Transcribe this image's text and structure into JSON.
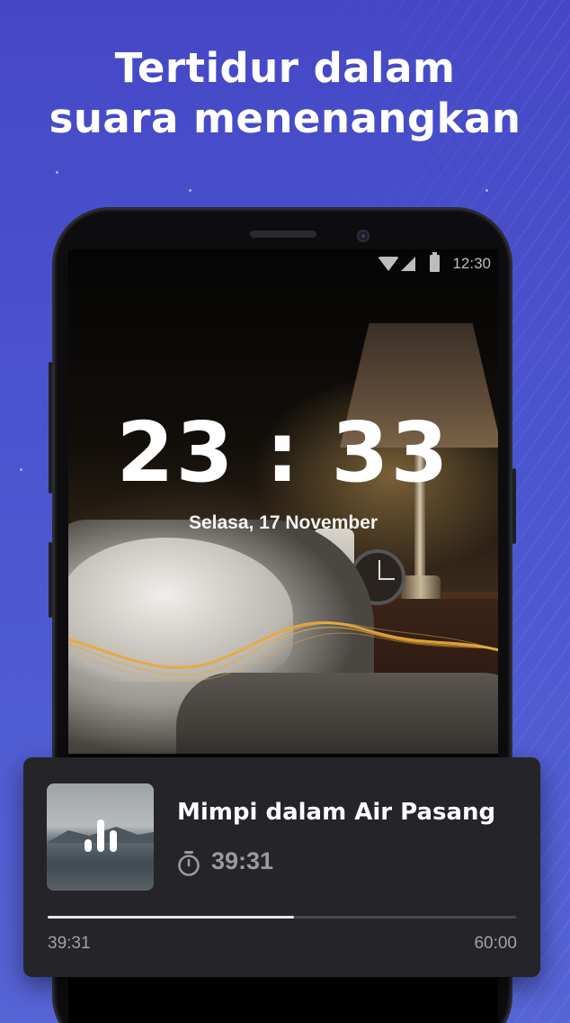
{
  "headline": {
    "line1": "Tertidur dalam",
    "line2": "suara menenangkan"
  },
  "status_bar": {
    "time": "12:30",
    "icons": [
      "wifi-icon",
      "signal-icon",
      "battery-icon"
    ]
  },
  "lock_screen": {
    "time": "23 : 33",
    "date": "Selasa, 17 November"
  },
  "player": {
    "title": "Mimpi dalam Air Pasang",
    "timer_icon": "timer-icon",
    "timer_value": "39:31",
    "elapsed": "39:31",
    "duration": "60:00",
    "progress_fraction": 0.5268,
    "thumbnail_icon": "equalizer-icon"
  },
  "colors": {
    "background": "#4a52cc",
    "wave_gold": "#e8a93a",
    "card": "#252428"
  }
}
